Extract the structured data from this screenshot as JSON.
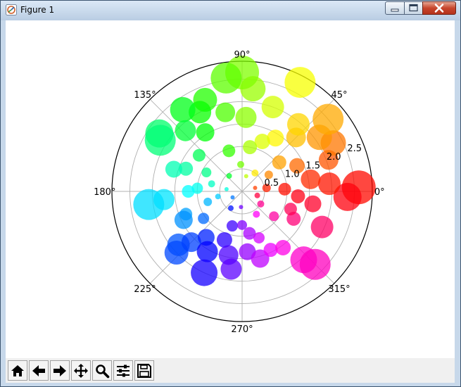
{
  "window": {
    "title": "Figure 1",
    "icon": "matplotlib-figure-icon",
    "controls": [
      "minimize-icon",
      "maximize-icon",
      "close-icon"
    ]
  },
  "toolbar": {
    "buttons": [
      {
        "name": "home-button",
        "icon": "home-icon"
      },
      {
        "name": "back-button",
        "icon": "arrow-left-icon"
      },
      {
        "name": "forward-button",
        "icon": "arrow-right-icon"
      },
      {
        "name": "pan-button",
        "icon": "move-icon"
      },
      {
        "name": "zoom-button",
        "icon": "magnifier-icon"
      },
      {
        "name": "subplots-button",
        "icon": "sliders-icon"
      },
      {
        "name": "save-button",
        "icon": "floppy-disk-icon"
      }
    ]
  },
  "chart_data": {
    "type": "scatter",
    "projection": "polar",
    "theta_ticks": [
      "0°",
      "45°",
      "90°",
      "135°",
      "180°",
      "225°",
      "270°",
      "315°"
    ],
    "r_ticks": [
      "0.5",
      "1.0",
      "1.5",
      "2.0",
      "2.5"
    ],
    "r_tick_values": [
      0.5,
      1.0,
      1.5,
      2.0,
      2.5
    ],
    "rlim": [
      0,
      2.9
    ],
    "grid": true,
    "colormap": "hsv",
    "alpha": 0.75,
    "legend": false,
    "points": [
      {
        "theta": 2,
        "r": 2.6,
        "size": 24
      },
      {
        "theta": 357,
        "r": 2.35,
        "size": 20
      },
      {
        "theta": 5,
        "r": 1.95,
        "size": 16
      },
      {
        "theta": 10,
        "r": 1.55,
        "size": 14
      },
      {
        "theta": 355,
        "r": 1.25,
        "size": 10
      },
      {
        "theta": 3,
        "r": 0.95,
        "size": 9
      },
      {
        "theta": 8,
        "r": 0.55,
        "size": 6
      },
      {
        "theta": 15,
        "r": 0.3,
        "size": 3
      },
      {
        "theta": 20,
        "r": 2.05,
        "size": 14
      },
      {
        "theta": 28,
        "r": 2.3,
        "size": 18
      },
      {
        "theta": 25,
        "r": 1.35,
        "size": 11
      },
      {
        "theta": 35,
        "r": 2.1,
        "size": 18
      },
      {
        "theta": 40,
        "r": 2.5,
        "size": 22
      },
      {
        "theta": 45,
        "r": 1.7,
        "size": 14
      },
      {
        "theta": 38,
        "r": 1.05,
        "size": 10
      },
      {
        "theta": 50,
        "r": 1.95,
        "size": 16
      },
      {
        "theta": 32,
        "r": 0.7,
        "size": 6
      },
      {
        "theta": 55,
        "r": 0.5,
        "size": 5
      },
      {
        "theta": 58,
        "r": 1.4,
        "size": 12
      },
      {
        "theta": 62,
        "r": 2.75,
        "size": 22
      },
      {
        "theta": 68,
        "r": 1.2,
        "size": 11
      },
      {
        "theta": 70,
        "r": 2.0,
        "size": 16
      },
      {
        "theta": 75,
        "r": 0.35,
        "size": 3
      },
      {
        "theta": 80,
        "r": 1.0,
        "size": 10
      },
      {
        "theta": 84,
        "r": 2.3,
        "size": 18
      },
      {
        "theta": 87,
        "r": 1.65,
        "size": 15
      },
      {
        "theta": 90,
        "r": 2.65,
        "size": 24
      },
      {
        "theta": 93,
        "r": 0.6,
        "size": 5
      },
      {
        "theta": 98,
        "r": 2.55,
        "size": 22
      },
      {
        "theta": 102,
        "r": 1.8,
        "size": 14
      },
      {
        "theta": 108,
        "r": 0.95,
        "size": 9
      },
      {
        "theta": 112,
        "r": 2.2,
        "size": 17
      },
      {
        "theta": 118,
        "r": 2.0,
        "size": 16
      },
      {
        "theta": 122,
        "r": 1.55,
        "size": 13
      },
      {
        "theta": 126,
        "r": 2.25,
        "size": 18
      },
      {
        "theta": 130,
        "r": 0.45,
        "size": 4
      },
      {
        "theta": 133,
        "r": 1.85,
        "size": 15
      },
      {
        "theta": 140,
        "r": 1.25,
        "size": 9
      },
      {
        "theta": 145,
        "r": 2.25,
        "size": 20
      },
      {
        "theta": 148,
        "r": 2.15,
        "size": 22
      },
      {
        "theta": 152,
        "r": 0.9,
        "size": 7
      },
      {
        "theta": 158,
        "r": 1.35,
        "size": 10
      },
      {
        "theta": 162,
        "r": 1.6,
        "size": 12
      },
      {
        "theta": 166,
        "r": 0.7,
        "size": 5
      },
      {
        "theta": 172,
        "r": 0.35,
        "size": 3
      },
      {
        "theta": 176,
        "r": 1.0,
        "size": 8
      },
      {
        "theta": 180,
        "r": 1.2,
        "size": 9
      },
      {
        "theta": 186,
        "r": 1.75,
        "size": 15
      },
      {
        "theta": 188,
        "r": 2.1,
        "size": 22
      },
      {
        "theta": 192,
        "r": 0.55,
        "size": 4
      },
      {
        "theta": 197,
        "r": 0.8,
        "size": 6
      },
      {
        "theta": 202,
        "r": 1.35,
        "size": 9
      },
      {
        "theta": 206,
        "r": 1.45,
        "size": 13
      },
      {
        "theta": 212,
        "r": 0.25,
        "size": 3
      },
      {
        "theta": 215,
        "r": 1.05,
        "size": 8
      },
      {
        "theta": 220,
        "r": 1.85,
        "size": 16
      },
      {
        "theta": 223,
        "r": 2.0,
        "size": 17
      },
      {
        "theta": 225,
        "r": 1.6,
        "size": 14
      },
      {
        "theta": 232,
        "r": 1.3,
        "size": 12
      },
      {
        "theta": 236,
        "r": 0.45,
        "size": 4
      },
      {
        "theta": 240,
        "r": 1.55,
        "size": 15
      },
      {
        "theta": 245,
        "r": 2.0,
        "size": 19
      },
      {
        "theta": 250,
        "r": 1.15,
        "size": 11
      },
      {
        "theta": 254,
        "r": 0.8,
        "size": 8
      },
      {
        "theta": 258,
        "r": 1.45,
        "size": 14
      },
      {
        "theta": 262,
        "r": 1.75,
        "size": 15
      },
      {
        "theta": 266,
        "r": 0.35,
        "size": 3
      },
      {
        "theta": 270,
        "r": 0.75,
        "size": 7
      },
      {
        "theta": 275,
        "r": 1.35,
        "size": 12
      },
      {
        "theta": 280,
        "r": 0.95,
        "size": 9
      },
      {
        "theta": 285,
        "r": 1.55,
        "size": 13
      },
      {
        "theta": 290,
        "r": 1.1,
        "size": 8
      },
      {
        "theta": 296,
        "r": 1.45,
        "size": 10
      },
      {
        "theta": 302,
        "r": 0.6,
        "size": 5
      },
      {
        "theta": 306,
        "r": 1.55,
        "size": 11
      },
      {
        "theta": 312,
        "r": 2.05,
        "size": 19
      },
      {
        "theta": 315,
        "r": 2.3,
        "size": 22
      },
      {
        "theta": 322,
        "r": 0.9,
        "size": 7
      },
      {
        "theta": 326,
        "r": 0.5,
        "size": 5
      },
      {
        "theta": 332,
        "r": 1.3,
        "size": 10
      },
      {
        "theta": 336,
        "r": 1.95,
        "size": 16
      },
      {
        "theta": 340,
        "r": 1.15,
        "size": 9
      },
      {
        "theta": 345,
        "r": 0.35,
        "size": 4
      },
      {
        "theta": 350,
        "r": 1.6,
        "size": 12
      }
    ]
  }
}
